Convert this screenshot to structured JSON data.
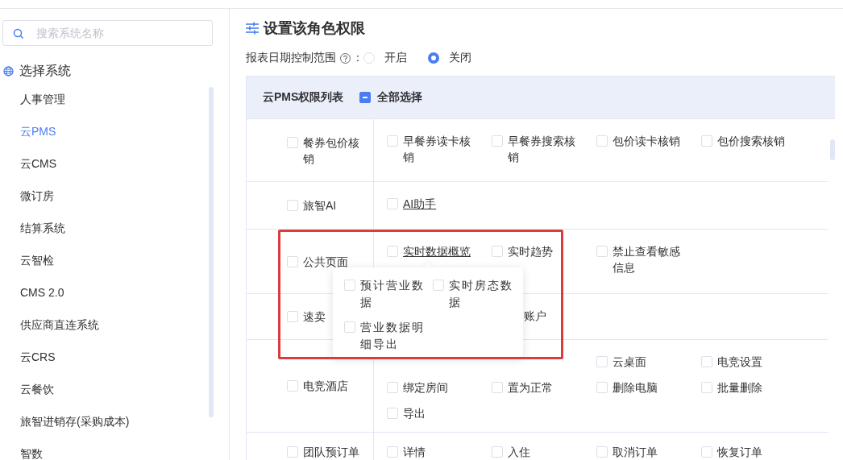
{
  "sidebar": {
    "search": {
      "placeholder": "搜索系统名称"
    },
    "heading": "选择系统",
    "items": [
      {
        "label": "人事管理",
        "selected": false
      },
      {
        "label": "云PMS",
        "selected": true
      },
      {
        "label": "云CMS",
        "selected": false
      },
      {
        "label": "微订房",
        "selected": false
      },
      {
        "label": "结算系统",
        "selected": false
      },
      {
        "label": "云智检",
        "selected": false
      },
      {
        "label": "CMS 2.0",
        "selected": false
      },
      {
        "label": "供应商直连系统",
        "selected": false
      },
      {
        "label": "云CRS",
        "selected": false
      },
      {
        "label": "云餐饮",
        "selected": false
      },
      {
        "label": "旅智进销存(采购成本)",
        "selected": false
      },
      {
        "label": "智数",
        "selected": false
      }
    ]
  },
  "main": {
    "title": "设置该角色权限",
    "date_control": {
      "label": "报表日期控制范围",
      "colon": "：",
      "options": [
        {
          "label": "开启",
          "selected": false
        },
        {
          "label": "关闭",
          "selected": true
        }
      ]
    },
    "table": {
      "title": "云PMS权限列表",
      "select_all": {
        "label": "全部选择",
        "indeterminate": true
      },
      "rows": [
        {
          "module": {
            "label": "餐券包价核销",
            "checked": false
          },
          "items": [
            {
              "kind": "plain",
              "label": "早餐券读卡核销",
              "checked": false
            },
            {
              "kind": "plain",
              "label": "早餐券搜索核销",
              "checked": false
            },
            {
              "kind": "plain",
              "label": "包价读卡核销",
              "checked": false
            },
            {
              "kind": "plain",
              "label": "包价搜索核销",
              "checked": false
            }
          ]
        },
        {
          "module": {
            "label": "旅智AI",
            "checked": false
          },
          "items": [
            {
              "kind": "link",
              "label": "AI助手",
              "checked": false
            }
          ]
        },
        {
          "module": {
            "label": "公共页面",
            "checked": false
          },
          "items": [
            {
              "kind": "link",
              "label": "实时数据概览",
              "checked": false
            },
            {
              "kind": "plain",
              "label": "实时趋势",
              "checked": false
            },
            {
              "kind": "plain",
              "label": "禁止查看敏感信息",
              "checked": false
            }
          ]
        },
        {
          "module": {
            "label": "速卖",
            "checked": false
          },
          "items": [
            {
              "kind": "covered"
            },
            {
              "kind": "partial",
              "label": "账户"
            }
          ]
        },
        {
          "module": {
            "label": "电竞酒店",
            "checked": false
          },
          "items": [
            {
              "kind": "covered"
            },
            {
              "kind": "covered"
            },
            {
              "kind": "plain",
              "label": "云桌面",
              "checked": false
            },
            {
              "kind": "plain",
              "label": "电竞设置",
              "checked": false
            },
            {
              "kind": "plain",
              "label": "绑定房间",
              "checked": false
            },
            {
              "kind": "plain",
              "label": "置为正常",
              "checked": false
            },
            {
              "kind": "plain",
              "label": "删除电脑",
              "checked": false
            },
            {
              "kind": "plain",
              "label": "批量删除",
              "checked": false
            },
            {
              "kind": "plain",
              "label": "导出",
              "checked": false
            }
          ]
        },
        {
          "module": {
            "label": "团队预订单",
            "checked": false
          },
          "items": [
            {
              "kind": "plain",
              "label": "详情",
              "checked": false
            },
            {
              "kind": "plain",
              "label": "入住",
              "checked": false
            },
            {
              "kind": "plain",
              "label": "取消订单",
              "checked": false
            },
            {
              "kind": "plain",
              "label": "恢复订单",
              "checked": false
            }
          ]
        }
      ],
      "popover": {
        "items": [
          {
            "label": "预计营业数据",
            "checked": false
          },
          {
            "label": "实时房态数据",
            "checked": false
          },
          {
            "label": "营业数据明细导出",
            "checked": false
          }
        ]
      }
    }
  }
}
